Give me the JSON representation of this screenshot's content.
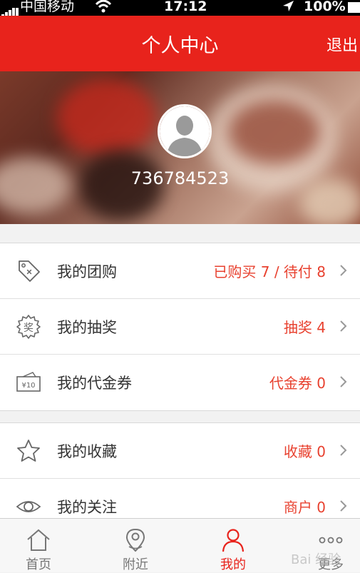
{
  "status_bar": {
    "carrier": "中国移动",
    "time": "17:12",
    "battery": "100%"
  },
  "nav": {
    "title": "个人中心",
    "logout": "退出"
  },
  "profile": {
    "username": "736784523"
  },
  "groups": [
    [
      {
        "icon": "tag-icon",
        "label": "我的团购",
        "value": "已购买 7 / 待付 8"
      },
      {
        "icon": "lottery-badge-icon",
        "label": "我的抽奖",
        "value": "抽奖 4"
      },
      {
        "icon": "voucher-icon",
        "label": "我的代金券",
        "value": "代金券 0",
        "icon_text": "¥10"
      }
    ],
    [
      {
        "icon": "star-icon",
        "label": "我的收藏",
        "value": "收藏 0"
      },
      {
        "icon": "eye-icon",
        "label": "我的关注",
        "value": "商户 0"
      }
    ]
  ],
  "lottery_icon_text": "奖",
  "tabs": [
    {
      "icon": "home-icon",
      "label": "首页",
      "active": false
    },
    {
      "icon": "location-pin-icon",
      "label": "附近",
      "active": false
    },
    {
      "icon": "person-icon",
      "label": "我的",
      "active": true
    },
    {
      "icon": "more-dots-icon",
      "label": "更多",
      "active": false
    }
  ],
  "colors": {
    "primary": "#e8231c",
    "value_text": "#e8412f"
  },
  "watermark": "Bai 经验"
}
